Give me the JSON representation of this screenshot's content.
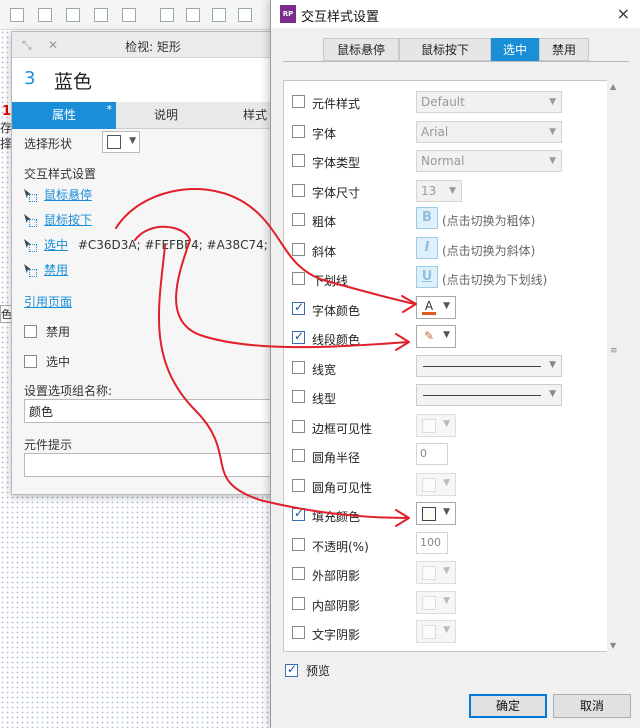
{
  "background": {
    "left_fragment_top": "存",
    "left_fragment_bottom": "择",
    "left_red_mark": "1",
    "left_select_fragment": "色"
  },
  "inspector": {
    "title": "检视: 矩形",
    "shape_number": "3",
    "shape_name": "蓝色",
    "tabs": [
      {
        "label": "属性",
        "active": true,
        "marker": "*"
      },
      {
        "label": "说明",
        "active": false
      },
      {
        "label": "样式",
        "active": false
      }
    ],
    "select_shape_label": "选择形状",
    "interaction_section_title": "交互样式设置",
    "interactions": [
      {
        "label": "鼠标悬停",
        "value": ""
      },
      {
        "label": "鼠标按下",
        "value": ""
      },
      {
        "label": "选中",
        "value": "#C36D3A; #FEFBF4; #A38C74;"
      },
      {
        "label": "禁用",
        "value": ""
      }
    ],
    "reference_page_label": "引用页面",
    "disabled_checkbox_label": "禁用",
    "selected_checkbox_label": "选中",
    "group_name_label": "设置选项组名称:",
    "group_name_value": "颜色",
    "tooltip_label": "元件提示",
    "tooltip_value": ""
  },
  "dialog": {
    "title": "交互样式设置",
    "close_icon": "×",
    "tabs": [
      {
        "label": "鼠标悬停",
        "active": false
      },
      {
        "label": "鼠标按下",
        "active": false
      },
      {
        "label": "选中",
        "active": true
      },
      {
        "label": "禁用",
        "active": false
      }
    ],
    "properties": [
      {
        "label": "元件样式",
        "checked": false,
        "control": "combo",
        "value": "Default"
      },
      {
        "label": "字体",
        "checked": false,
        "control": "combo",
        "value": "Arial"
      },
      {
        "label": "字体类型",
        "checked": false,
        "control": "combo",
        "value": "Normal"
      },
      {
        "label": "字体尺寸",
        "checked": false,
        "control": "small-combo",
        "value": "13"
      },
      {
        "label": "粗体",
        "checked": false,
        "control": "toggle",
        "glyph": "B",
        "hint": "(点击切换为粗体)"
      },
      {
        "label": "斜体",
        "checked": false,
        "control": "toggle",
        "glyph": "I",
        "hint": "(点击切换为斜体)"
      },
      {
        "label": "下划线",
        "checked": false,
        "control": "toggle",
        "glyph": "U",
        "hint": "(点击切换为下划线)"
      },
      {
        "label": "字体颜色",
        "checked": true,
        "control": "color",
        "glyph": "A",
        "color": "#e05a1e"
      },
      {
        "label": "线段颜色",
        "checked": true,
        "control": "color",
        "glyph": "✎",
        "color": "#c36d3a"
      },
      {
        "label": "线宽",
        "checked": false,
        "control": "line"
      },
      {
        "label": "线型",
        "checked": false,
        "control": "line"
      },
      {
        "label": "边框可见性",
        "checked": false,
        "control": "color-dim"
      },
      {
        "label": "圆角半径",
        "checked": false,
        "control": "number",
        "value": "0"
      },
      {
        "label": "圆角可见性",
        "checked": false,
        "control": "color-dim"
      },
      {
        "label": "填充颜色",
        "checked": true,
        "control": "color",
        "color": "#fefbf4"
      },
      {
        "label": "不透明(%)",
        "checked": false,
        "control": "number",
        "value": "100"
      },
      {
        "label": "外部阴影",
        "checked": false,
        "control": "color-dim"
      },
      {
        "label": "内部阴影",
        "checked": false,
        "control": "color-dim"
      },
      {
        "label": "文字阴影",
        "checked": false,
        "control": "color-dim"
      }
    ],
    "preview_label": "预览",
    "ok_label": "确定",
    "cancel_label": "取消"
  },
  "colors": {
    "accent": "#1a8fd8",
    "annotation": "#e0202a"
  }
}
